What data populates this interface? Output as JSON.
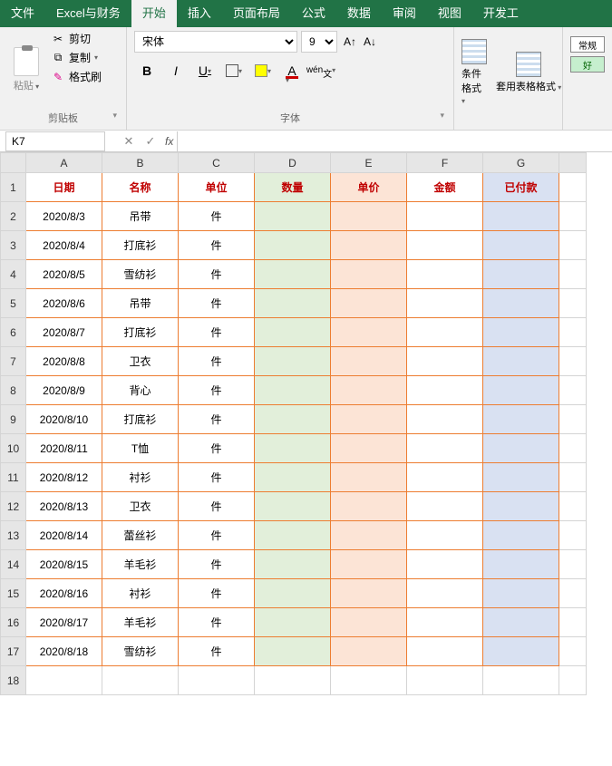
{
  "tabs": [
    "文件",
    "Excel与财务",
    "开始",
    "插入",
    "页面布局",
    "公式",
    "数据",
    "审阅",
    "视图",
    "开发工"
  ],
  "active_tab": 2,
  "clipboard": {
    "paste": "粘贴",
    "cut": "剪切",
    "copy": "复制",
    "format_painter": "格式刷",
    "group_label": "剪贴板"
  },
  "font": {
    "name": "宋体",
    "size": "9",
    "group_label": "字体",
    "bold": "B",
    "italic": "I",
    "underline": "U",
    "wen": "wén"
  },
  "styles": {
    "cond_fmt": "条件格式",
    "table_fmt": "套用表格格式",
    "normal": "常规",
    "good": "好"
  },
  "namebox": "K7",
  "fx": "fx",
  "columns": [
    "A",
    "B",
    "C",
    "D",
    "E",
    "F",
    "G"
  ],
  "headers": [
    "日期",
    "名称",
    "单位",
    "数量",
    "单价",
    "金额",
    "已付款"
  ],
  "rows": [
    {
      "a": "2020/8/3",
      "b": "吊带",
      "c": "件"
    },
    {
      "a": "2020/8/4",
      "b": "打底衫",
      "c": "件"
    },
    {
      "a": "2020/8/5",
      "b": "雪纺衫",
      "c": "件"
    },
    {
      "a": "2020/8/6",
      "b": "吊带",
      "c": "件"
    },
    {
      "a": "2020/8/7",
      "b": "打底衫",
      "c": "件"
    },
    {
      "a": "2020/8/8",
      "b": "卫衣",
      "c": "件"
    },
    {
      "a": "2020/8/9",
      "b": "背心",
      "c": "件"
    },
    {
      "a": "2020/8/10",
      "b": "打底衫",
      "c": "件"
    },
    {
      "a": "2020/8/11",
      "b": "T恤",
      "c": "件"
    },
    {
      "a": "2020/8/12",
      "b": "衬衫",
      "c": "件"
    },
    {
      "a": "2020/8/13",
      "b": "卫衣",
      "c": "件"
    },
    {
      "a": "2020/8/14",
      "b": "蕾丝衫",
      "c": "件"
    },
    {
      "a": "2020/8/15",
      "b": "羊毛衫",
      "c": "件"
    },
    {
      "a": "2020/8/16",
      "b": "衬衫",
      "c": "件"
    },
    {
      "a": "2020/8/17",
      "b": "羊毛衫",
      "c": "件"
    },
    {
      "a": "2020/8/18",
      "b": "雪纺衫",
      "c": "件"
    }
  ]
}
